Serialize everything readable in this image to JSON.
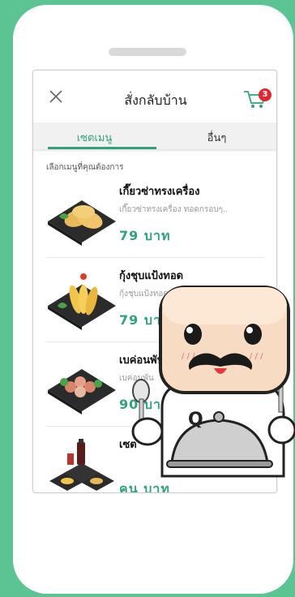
{
  "header": {
    "title": "สั่งกลับบ้าน",
    "cart_count": "3"
  },
  "tabs": [
    {
      "label": "เซตเมนู",
      "active": true
    },
    {
      "label": "อื่นๆ",
      "active": false
    }
  ],
  "subtitle": "เลือกเมนูที่คุณต้องการ",
  "items": [
    {
      "name": "เกี๊ยวซ่าทรงเครื่อง",
      "desc": "เกี๊ยวซ่าทรงเครื่อง ทอดกรอบๆ..",
      "price": "79 บาท"
    },
    {
      "name": "กุ้งชุบแป้งทอด",
      "desc": "กุ้งชุบแป้งทอด ...",
      "price": "79 บาท"
    },
    {
      "name": "เบค่อนพัน",
      "desc": "เบค่อนพัน",
      "price": "90 บาท"
    },
    {
      "name": "เซต",
      "desc": "",
      "price": "คน บาท"
    }
  ],
  "colors": {
    "background": "#5cc393",
    "accent": "#2fa37a",
    "badge": "#e2262f"
  }
}
